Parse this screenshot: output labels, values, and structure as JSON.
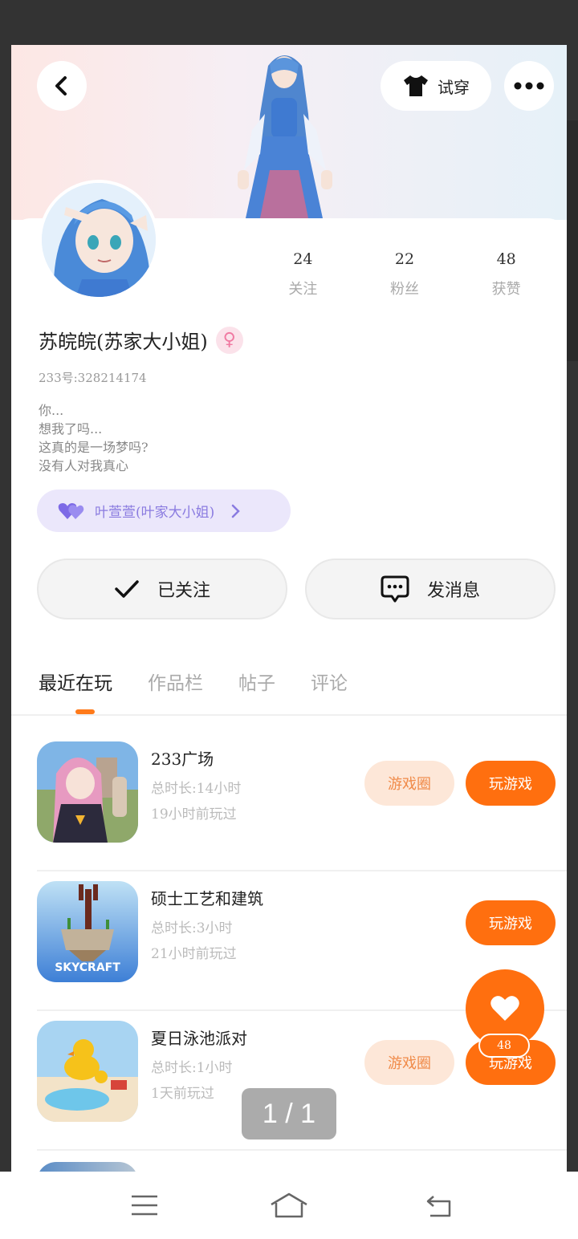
{
  "header": {
    "try_on_label": "试穿"
  },
  "profile": {
    "name": "苏皖皖(苏家大小姐)",
    "gender_symbol": "♀",
    "uid": "233号:328214174",
    "bio_lines": [
      "你...",
      "想我了吗...",
      "这真的是一场梦吗?",
      "没有人对我真心"
    ],
    "stats": [
      {
        "value": "24",
        "label": "关注"
      },
      {
        "value": "22",
        "label": "粉丝"
      },
      {
        "value": "48",
        "label": "获赞"
      }
    ],
    "relation_label": "叶萱萱(叶家大小姐)"
  },
  "actions": {
    "follow_label": "已关注",
    "message_label": "发消息"
  },
  "tabs": [
    {
      "label": "最近在玩",
      "active": true
    },
    {
      "label": "作品栏",
      "active": false
    },
    {
      "label": "帖子",
      "active": false
    },
    {
      "label": "评论",
      "active": false
    }
  ],
  "games": [
    {
      "name": "233广场",
      "duration": "总时长:14小时",
      "last_played": "19小时前玩过",
      "circle_label": "游戏圈",
      "play_label": "玩游戏",
      "has_circle": true
    },
    {
      "name": "硕士工艺和建筑",
      "duration": "总时长:3小时",
      "last_played": "21小时前玩过",
      "icon_text": "SKYCRAFT",
      "play_label": "玩游戏",
      "has_circle": false
    },
    {
      "name": "夏日泳池派对",
      "duration": "总时长:1小时",
      "last_played": "1天前玩过",
      "circle_label": "游戏圈",
      "play_label": "玩游戏",
      "has_circle": true
    }
  ],
  "like_fab": {
    "count": "48"
  },
  "page_indicator": "1 / 1",
  "colors": {
    "accent": "#ff6f0f",
    "accent_light": "#fde7d8",
    "relation": "#8a7be0"
  }
}
